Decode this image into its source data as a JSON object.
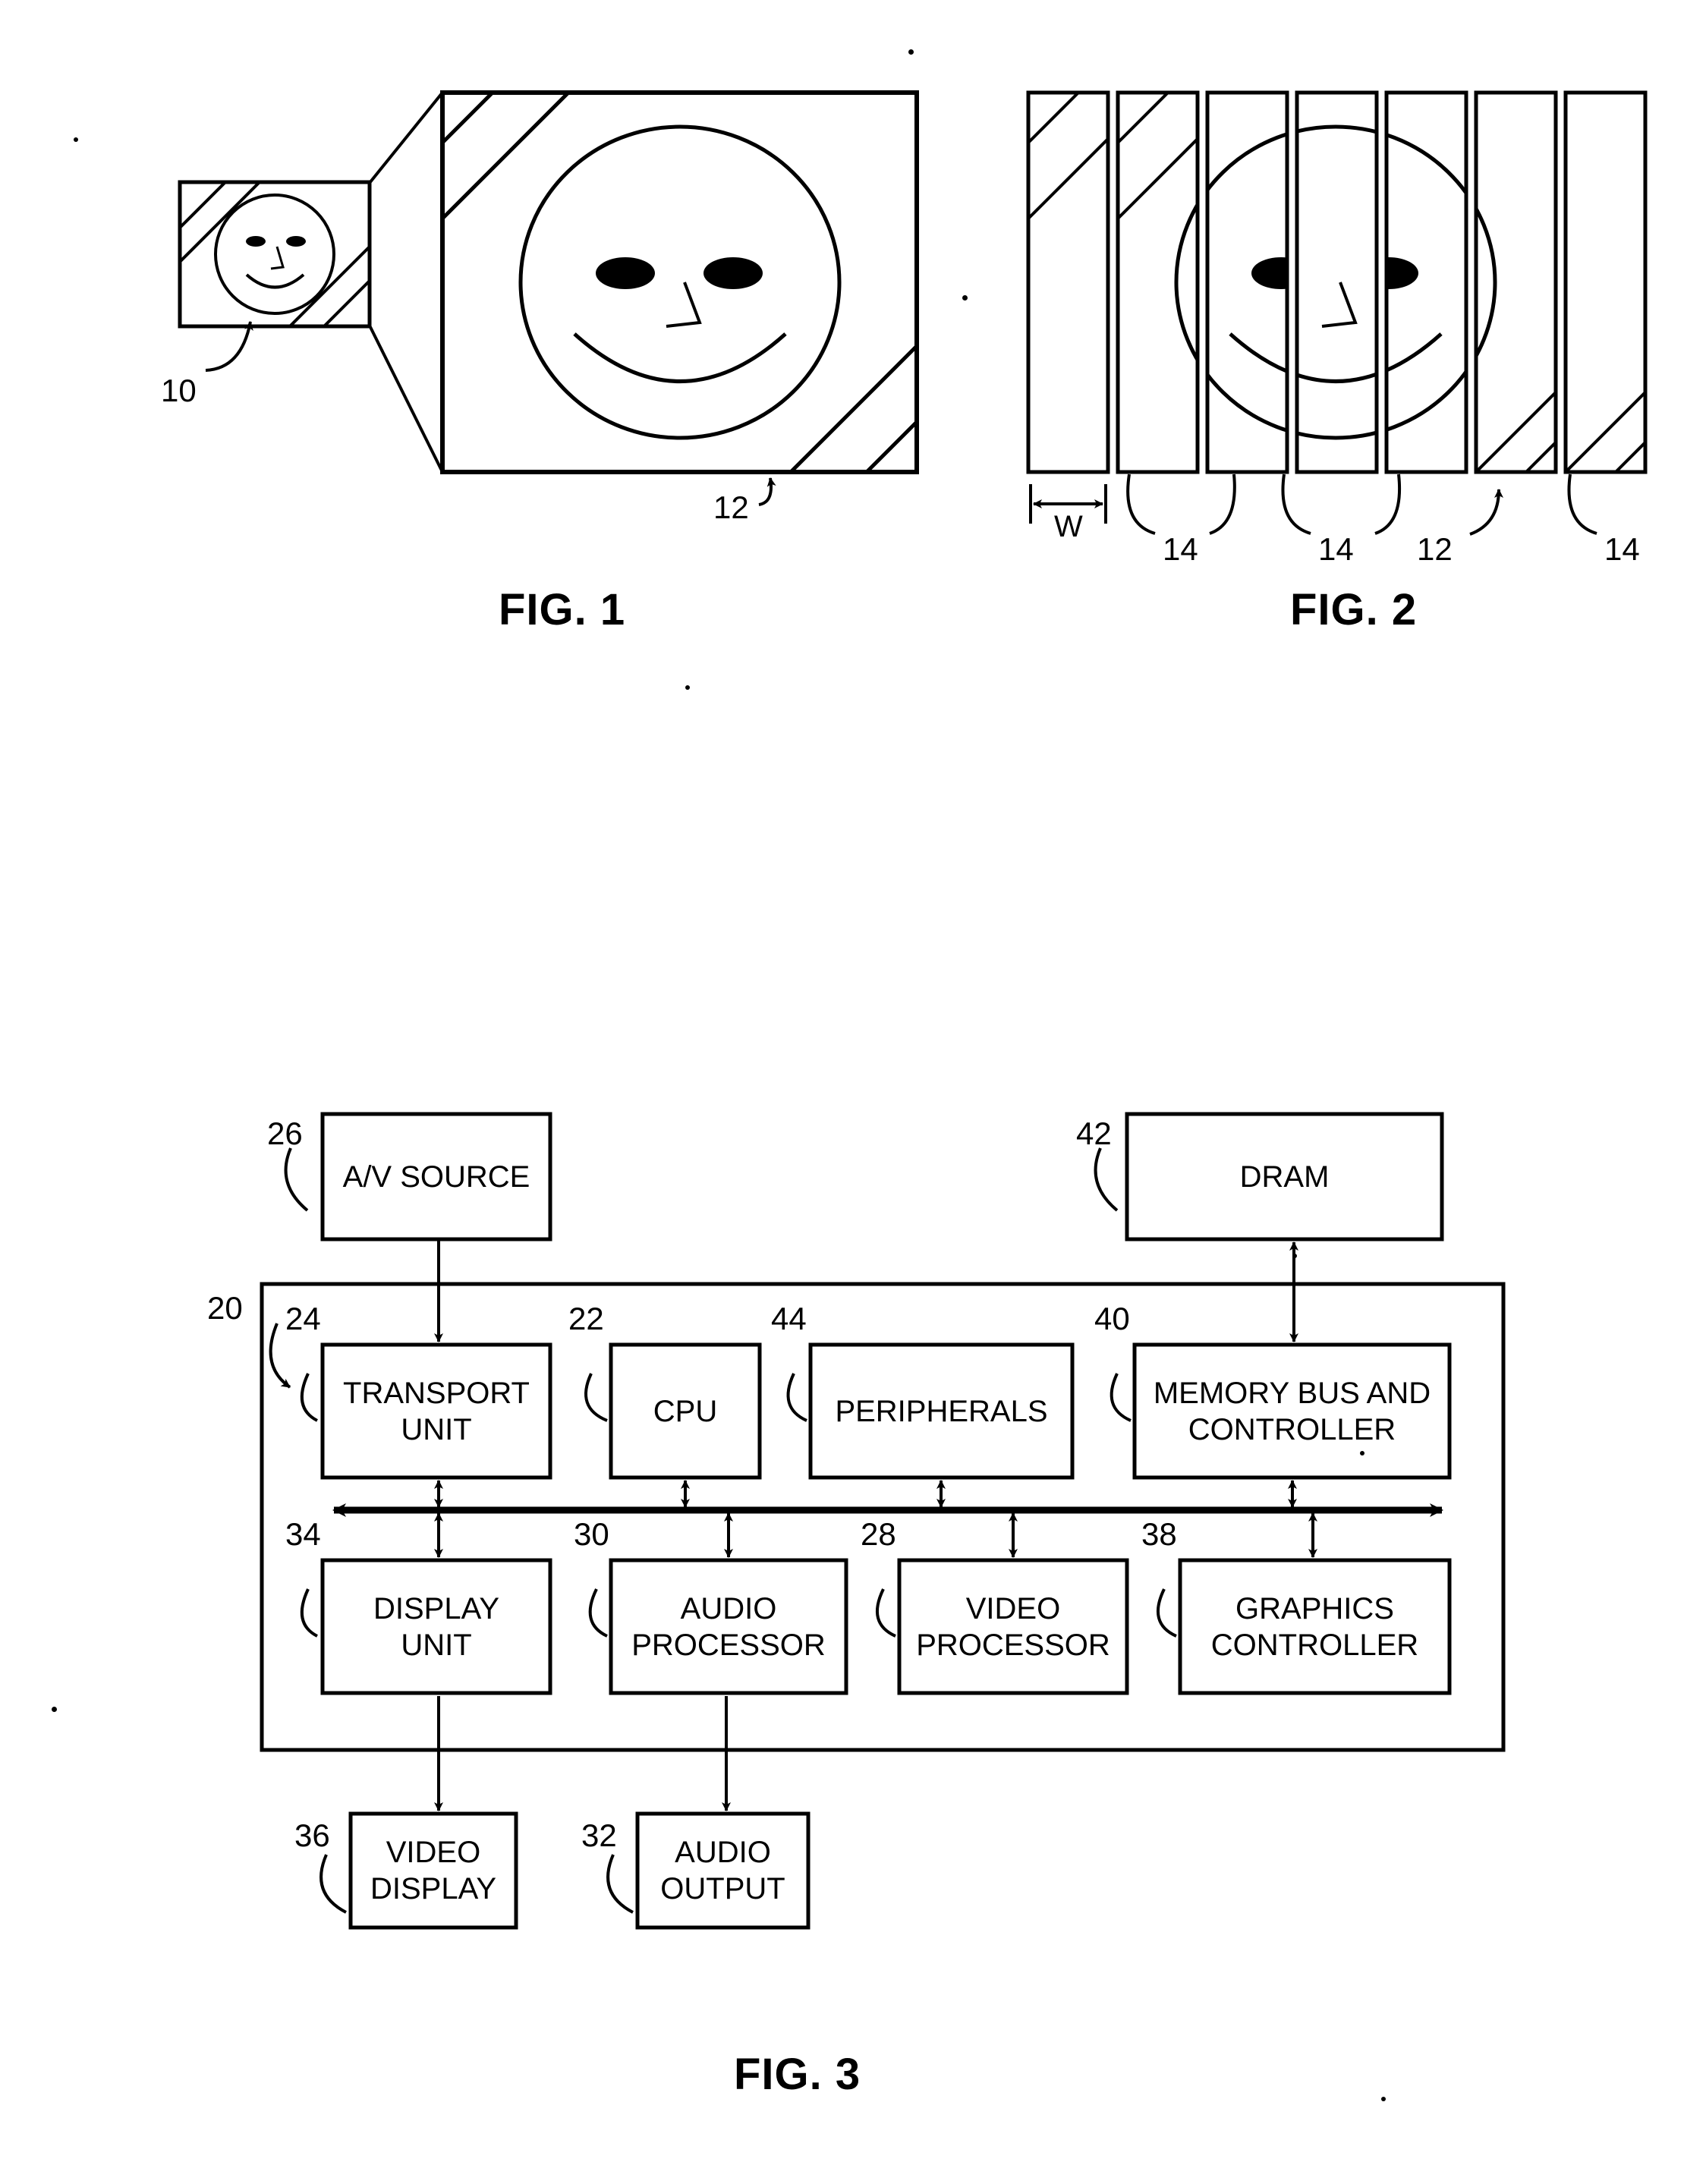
{
  "document": {
    "kind": "patent-drawing-sheet",
    "background_color": "#ffffff",
    "ink_color": "#000000"
  },
  "figures": [
    {
      "caption": "FIG. 1",
      "description": "Small framed image of a smiley face with a magnified callout view of the same framed image.",
      "reference_numerals": [
        {
          "label": "10",
          "points_to": "small-framed-image"
        },
        {
          "label": "12",
          "points_to": "enlarged-frame-border"
        }
      ],
      "face": {
        "eyes": 2,
        "nose": 1,
        "mouth": "smile"
      }
    },
    {
      "caption": "FIG. 2",
      "description": "The same image decomposed into seven vertical strips of width W, with hatched border regions.",
      "strip_count": 7,
      "width_label": "W",
      "reference_numerals": [
        {
          "label": "W",
          "points_to": "strip-width-dimension"
        },
        {
          "label": "14",
          "points_to": "strip-2"
        },
        {
          "label": "14",
          "points_to": "strip-3"
        },
        {
          "label": "14",
          "points_to": "strip-4"
        },
        {
          "label": "12",
          "points_to": "strip-5"
        },
        {
          "label": "14",
          "points_to": "strip-7"
        }
      ]
    },
    {
      "caption": "FIG. 3",
      "description": "Block diagram of an audio/video processing system built around an integrated circuit and a shared internal bus."
    }
  ],
  "block_diagram": {
    "chip": {
      "ref": "20",
      "name": "integrated-circuit-boundary"
    },
    "external_blocks": [
      {
        "id": "av-source",
        "label": "A/V SOURCE",
        "ref": "26"
      },
      {
        "id": "dram",
        "label": "DRAM",
        "ref": "42"
      },
      {
        "id": "video-display",
        "label": "VIDEO\nDISPLAY",
        "ref": "36"
      },
      {
        "id": "audio-output",
        "label": "AUDIO\nOUTPUT",
        "ref": "32"
      }
    ],
    "top_row_blocks": [
      {
        "id": "transport-unit",
        "label": "TRANSPORT\nUNIT",
        "ref": "24"
      },
      {
        "id": "cpu",
        "label": "CPU",
        "ref": "22"
      },
      {
        "id": "peripherals",
        "label": "PERIPHERALS",
        "ref": "44"
      },
      {
        "id": "memory-bus-and-controller",
        "label": "MEMORY BUS AND\nCONTROLLER",
        "ref": "40"
      }
    ],
    "bottom_row_blocks": [
      {
        "id": "display-unit",
        "label": "DISPLAY\nUNIT",
        "ref": "34"
      },
      {
        "id": "audio-processor",
        "label": "AUDIO\nPROCESSOR",
        "ref": "30"
      },
      {
        "id": "video-processor",
        "label": "VIDEO\nPROCESSOR",
        "ref": "28"
      },
      {
        "id": "graphics-controller",
        "label": "GRAPHICS\nCONTROLLER",
        "ref": "38"
      }
    ],
    "bus": {
      "id": "internal-bus",
      "style": "double-headed-horizontal-arrow"
    },
    "connections": [
      {
        "from": "av-source",
        "to": "transport-unit",
        "arrow": "single-down"
      },
      {
        "from": "memory-bus-and-controller",
        "to": "dram",
        "arrow": "double-vertical"
      },
      {
        "from": "transport-unit",
        "to": "internal-bus",
        "arrow": "double-vertical"
      },
      {
        "from": "cpu",
        "to": "internal-bus",
        "arrow": "double-vertical"
      },
      {
        "from": "peripherals",
        "to": "internal-bus",
        "arrow": "double-vertical"
      },
      {
        "from": "memory-bus-and-controller",
        "to": "internal-bus",
        "arrow": "double-vertical"
      },
      {
        "from": "internal-bus",
        "to": "display-unit",
        "arrow": "double-vertical"
      },
      {
        "from": "internal-bus",
        "to": "audio-processor",
        "arrow": "double-vertical"
      },
      {
        "from": "internal-bus",
        "to": "video-processor",
        "arrow": "double-vertical"
      },
      {
        "from": "internal-bus",
        "to": "graphics-controller",
        "arrow": "double-vertical"
      },
      {
        "from": "display-unit",
        "to": "video-display",
        "arrow": "single-down"
      },
      {
        "from": "audio-processor",
        "to": "audio-output",
        "arrow": "single-down"
      }
    ]
  },
  "labels": {
    "fig1_caption": "FIG. 1",
    "fig2_caption": "FIG. 2",
    "fig3_caption": "FIG. 3",
    "ref_10": "10",
    "ref_12_fig1": "12",
    "ref_w": "W",
    "ref_14_a": "14",
    "ref_14_b": "14",
    "ref_12_fig2": "12",
    "ref_14_c": "14",
    "ref_20": "20",
    "ref_22": "22",
    "ref_24": "24",
    "ref_26": "26",
    "ref_28": "28",
    "ref_30": "30",
    "ref_32": "32",
    "ref_34": "34",
    "ref_36": "36",
    "ref_38": "38",
    "ref_40": "40",
    "ref_42": "42",
    "ref_44": "44",
    "av_source": "A/V SOURCE",
    "dram": "DRAM",
    "transport_unit": "TRANSPORT\nUNIT",
    "cpu": "CPU",
    "peripherals": "PERIPHERALS",
    "memory_bus": "MEMORY BUS AND\nCONTROLLER",
    "display_unit": "DISPLAY\nUNIT",
    "audio_processor": "AUDIO\nPROCESSOR",
    "video_processor": "VIDEO\nPROCESSOR",
    "graphics_controller": "GRAPHICS\nCONTROLLER",
    "video_display": "VIDEO\nDISPLAY",
    "audio_output": "AUDIO\nOUTPUT"
  }
}
